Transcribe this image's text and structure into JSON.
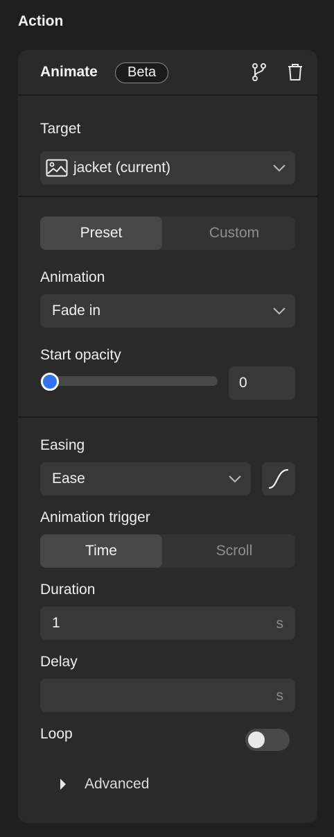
{
  "panel": {
    "title": "Action"
  },
  "card": {
    "title": "Animate",
    "badge": "Beta",
    "header_icons": [
      "branch-icon",
      "trash-icon"
    ]
  },
  "target": {
    "label": "Target",
    "value": "jacket (current)",
    "icon": "image-icon"
  },
  "mode_toggle": {
    "options": [
      "Preset",
      "Custom"
    ],
    "selected": "Preset"
  },
  "animation": {
    "label": "Animation",
    "value": "Fade in"
  },
  "start_opacity": {
    "label": "Start opacity",
    "value": "0",
    "slider_fraction": 0
  },
  "easing": {
    "label": "Easing",
    "value": "Ease",
    "curve_icon": "ease-curve-icon"
  },
  "trigger": {
    "label": "Animation trigger",
    "options": [
      "Time",
      "Scroll"
    ],
    "selected": "Time"
  },
  "duration": {
    "label": "Duration",
    "value": "1",
    "unit": "s"
  },
  "delay": {
    "label": "Delay",
    "value": "",
    "unit": "s"
  },
  "loop": {
    "label": "Loop",
    "enabled": false
  },
  "advanced": {
    "label": "Advanced"
  },
  "colors": {
    "accent": "#2f73f0",
    "background": "#1f1f1f",
    "card": "#2a2a2a",
    "field": "#383838"
  }
}
